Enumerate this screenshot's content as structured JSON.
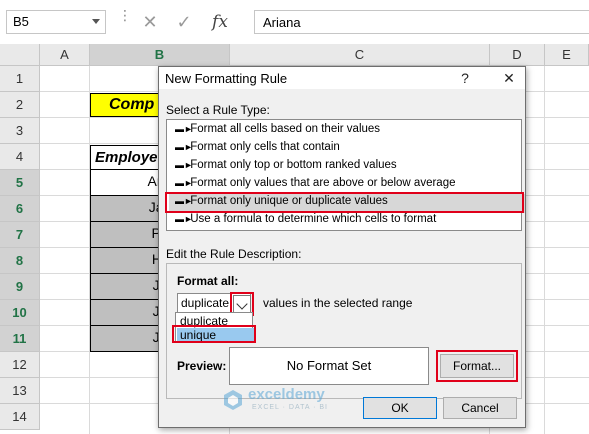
{
  "formula_bar": {
    "name_box": "B5",
    "cancel_icon": "✕",
    "enter_icon": "✓",
    "fx_label": "fx",
    "formula_value": "Ariana"
  },
  "columns": [
    "A",
    "B",
    "C",
    "D",
    "E"
  ],
  "rows": [
    "1",
    "2",
    "3",
    "4",
    "5",
    "6",
    "7",
    "8",
    "9",
    "10",
    "11",
    "12",
    "13",
    "14"
  ],
  "sheet": {
    "title_cell": "Comp",
    "header_cell": "Employe",
    "names": [
      "Aria",
      "Jan",
      "Pa",
      "Hil",
      "Ja",
      "Ja",
      "Ju"
    ]
  },
  "dialog": {
    "title": "New Formatting Rule",
    "help": "?",
    "close": "✕",
    "select_rule_label": "Select a Rule Type:",
    "rule_types": [
      "Format all cells based on their values",
      "Format only cells that contain",
      "Format only top or bottom ranked values",
      "Format only values that are above or below average",
      "Format only unique or duplicate values",
      "Use a formula to determine which cells to format"
    ],
    "edit_desc_label": "Edit the Rule Description:",
    "format_all_label": "Format all:",
    "combo_value": "duplicate",
    "combo_suffix": "values in the selected range",
    "dropdown_options": [
      "duplicate",
      "unique"
    ],
    "preview_label": "Preview:",
    "preview_text": "No Format Set",
    "format_button": "Format...",
    "ok_button": "OK",
    "cancel_button": "Cancel"
  },
  "watermark": {
    "name": "exceldemy",
    "tagline": "EXCEL · DATA · BI"
  },
  "colors": {
    "highlight_red": "#e0001a",
    "title_yellow": "#ffff00",
    "selected_grey": "#bfbfbf",
    "dropdown_blue": "#99c9ef"
  }
}
